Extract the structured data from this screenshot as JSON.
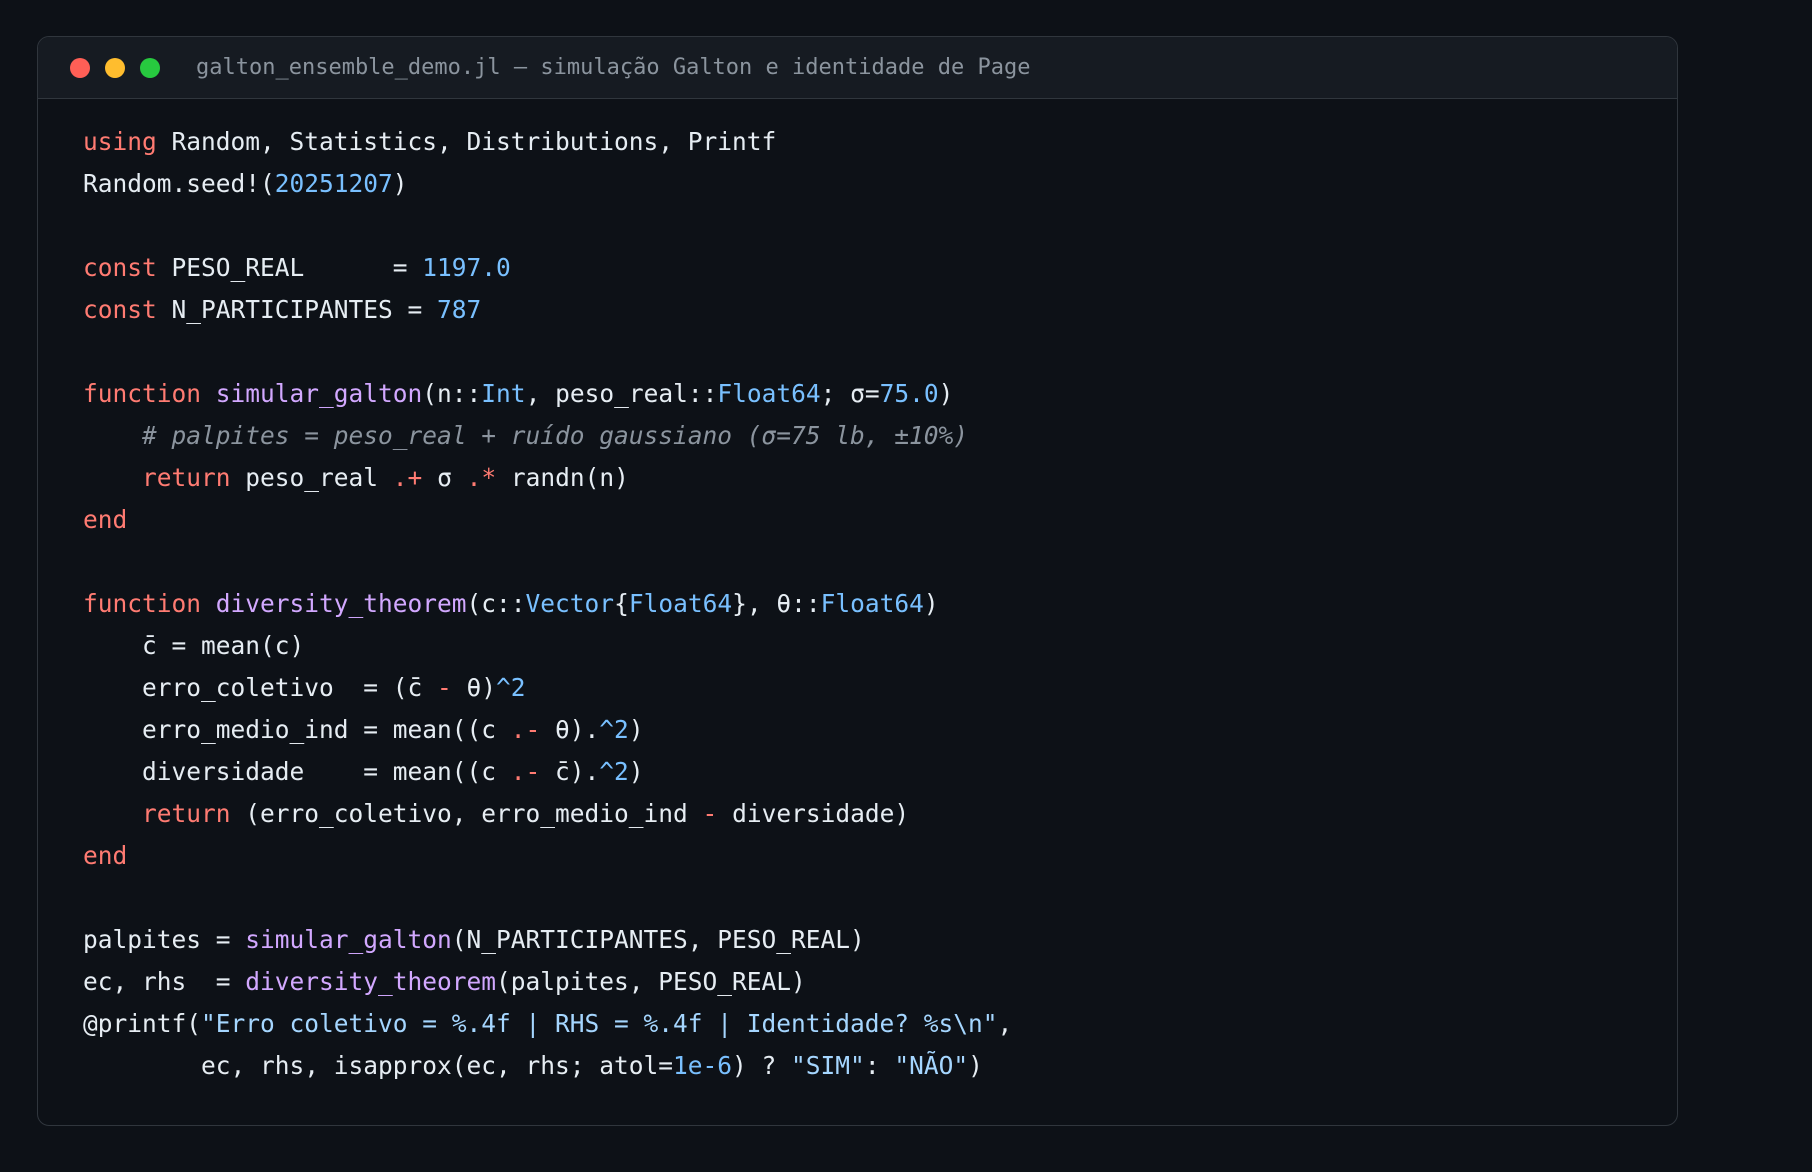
{
  "window": {
    "title": "galton_ensemble_demo.jl — simulação Galton e identidade de Page"
  },
  "code": {
    "language": "julia",
    "lines": [
      [
        [
          "kw",
          "using"
        ],
        [
          "",
          "Random, Statistics, Distributions, Printf"
        ]
      ],
      [
        [
          "",
          "Random.seed!("
        ],
        [
          "num",
          "20251207"
        ],
        [
          "",
          ")"
        ]
      ],
      [],
      [
        [
          "kw",
          "const"
        ],
        [
          "",
          "PESO_REAL      = "
        ],
        [
          "num",
          "1197.0"
        ]
      ],
      [
        [
          "kw",
          "const"
        ],
        [
          "",
          "N_PARTICIPANTES = "
        ],
        [
          "num",
          "787"
        ]
      ],
      [],
      [
        [
          "kw",
          "function"
        ],
        [
          "fn",
          "simular_galton"
        ],
        [
          "",
          "(n::"
        ],
        [
          "ty",
          "Int"
        ],
        [
          "",
          ", peso_real::"
        ],
        [
          "ty",
          "Float64"
        ],
        [
          "",
          "; σ="
        ],
        [
          "num",
          "75.0"
        ],
        [
          "",
          ")"
        ]
      ],
      [
        [
          "",
          "    "
        ],
        [
          "cm",
          "# palpites = peso_real + ruído gaussiano (σ=75 lb, ±10%)"
        ]
      ],
      [
        [
          "",
          "    "
        ],
        [
          "kw",
          "return"
        ],
        [
          "",
          "peso_real "
        ],
        [
          "op",
          ".+"
        ],
        [
          "",
          ""
        ],
        [
          "",
          "σ "
        ],
        [
          "op",
          ".*"
        ],
        [
          "",
          ""
        ],
        [
          "",
          "randn(n)"
        ]
      ],
      [
        [
          "kw",
          "end"
        ]
      ],
      [],
      [
        [
          "kw",
          "function"
        ],
        [
          "fn",
          "diversity_theorem"
        ],
        [
          "",
          "(c::"
        ],
        [
          "ty",
          "Vector"
        ],
        [
          "",
          "{"
        ],
        [
          "ty",
          "Float64"
        ],
        [
          "",
          "}, θ::"
        ],
        [
          "ty",
          "Float64"
        ],
        [
          "",
          ")"
        ]
      ],
      [
        [
          "",
          "    c̄ = mean(c)"
        ]
      ],
      [
        [
          "",
          "    erro_coletivo  = (c̄ "
        ],
        [
          "op",
          "-"
        ],
        [
          "",
          ""
        ],
        [
          "",
          "θ)"
        ],
        [
          "num",
          "^2"
        ]
      ],
      [
        [
          "",
          "    erro_medio_ind = mean((c "
        ],
        [
          "op",
          ".-"
        ],
        [
          "",
          ""
        ],
        [
          "",
          "θ)."
        ],
        [
          "num",
          "^2"
        ],
        [
          "",
          ")"
        ]
      ],
      [
        [
          "",
          "    diversidade    = mean((c "
        ],
        [
          "op",
          ".-"
        ],
        [
          "",
          ""
        ],
        [
          "",
          "c̄)."
        ],
        [
          "num",
          "^2"
        ],
        [
          "",
          ")"
        ]
      ],
      [
        [
          "",
          "    "
        ],
        [
          "kw",
          "return"
        ],
        [
          "",
          "(erro_coletivo, erro_medio_ind "
        ],
        [
          "op",
          "-"
        ],
        [
          "",
          ""
        ],
        [
          "",
          "diversidade)"
        ]
      ],
      [
        [
          "kw",
          "end"
        ]
      ],
      [],
      [
        [
          "",
          "palpites = "
        ],
        [
          "fn",
          "simular_galton"
        ],
        [
          "",
          "(N_PARTICIPANTES, PESO_REAL)"
        ]
      ],
      [
        [
          "",
          "ec, rhs  = "
        ],
        [
          "fn",
          "diversity_theorem"
        ],
        [
          "",
          "(palpites, PESO_REAL)"
        ]
      ],
      [
        [
          "",
          "@printf("
        ],
        [
          "str",
          "\"Erro coletivo = %.4f | RHS = %.4f | Identidade? %s\\n\""
        ],
        [
          "",
          ","
        ]
      ],
      [
        [
          "",
          "        ec, rhs, isapprox(ec, rhs; atol="
        ],
        [
          "num",
          "1e-6"
        ],
        [
          "",
          ") ? "
        ],
        [
          "str",
          "\"SIM\""
        ],
        [
          "",
          ""
        ],
        [
          "",
          ": "
        ],
        [
          "str",
          "\"NÃO\""
        ],
        [
          "",
          ")"
        ]
      ]
    ]
  },
  "colors": {
    "background": "#0d1117",
    "keyword": "#ff7b72",
    "function": "#d2a8ff",
    "number": "#79c0ff",
    "string": "#a5d6ff",
    "comment": "#8b949e",
    "text": "#e6edf3"
  },
  "icons": [
    "close-dot",
    "minimize-dot",
    "maximize-dot"
  ]
}
